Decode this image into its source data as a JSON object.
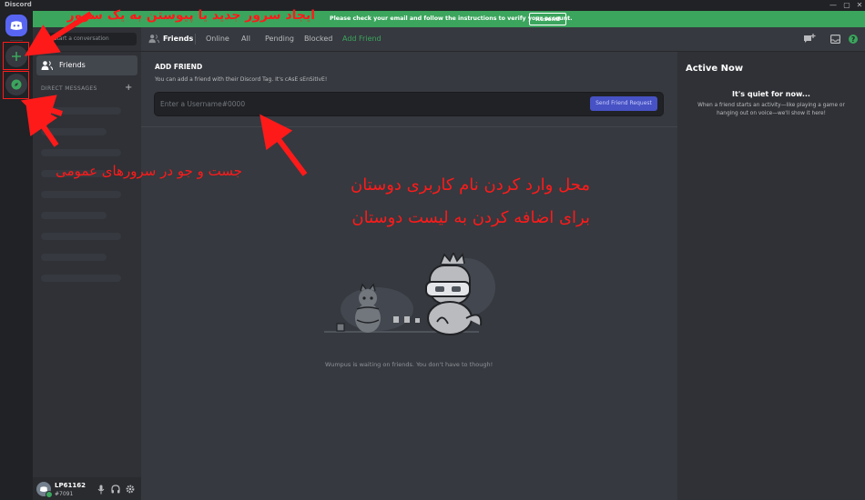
{
  "window": {
    "title": "Discord",
    "controls": [
      "—",
      "▢",
      "✕"
    ]
  },
  "banner": {
    "message": "Please check your email and follow the instructions to verify your account.",
    "button": "Resend",
    "color": "#3ba55d"
  },
  "sidebar": {
    "search_placeholder": "Find or start a conversation",
    "search_visible_text": "r start a conversation",
    "friends_label": "Friends",
    "direct_messages_header": "DIRECT MESSAGES",
    "add_dm_icon": "+"
  },
  "user": {
    "name": "LP61162",
    "tag": "#7091"
  },
  "header": {
    "friends_title": "Friends",
    "tabs": [
      "Online",
      "All",
      "Pending",
      "Blocked"
    ],
    "add_friend_tab": "Add Friend"
  },
  "add_friend": {
    "title": "ADD FRIEND",
    "description": "You can add a friend with their Discord Tag. It's cAsE sEnSitIvE!",
    "input_placeholder": "Enter a Username#0000",
    "button": "Send Friend Request"
  },
  "empty_state": {
    "caption": "Wumpus is waiting on friends. You don't have to though!"
  },
  "active_now": {
    "title": "Active Now",
    "quiet_title": "It's quiet for now...",
    "quiet_text_line1": "When a friend starts an activity—like playing a game or",
    "quiet_text_line2": "hanging out on voice—we'll show it here!"
  },
  "annotations": {
    "top": "ایجاد سرور جدید یا پیوستن به یک سرور",
    "left": "جست و جو در سرورهای عمومی",
    "center_line1": "محل وارد کردن نام کاربری دوستان",
    "center_line2": "برای اضافه کردن به لیست دوستان"
  },
  "colors": {
    "blurple": "#5865f2",
    "green": "#3ba55d",
    "annotation_red": "#ff1a1a",
    "button": "#4752c4"
  },
  "icons": [
    "discord-logo-icon",
    "plus-icon",
    "compass-icon",
    "friends-icon",
    "new-group-dm-icon",
    "inbox-icon",
    "help-icon",
    "microphone-icon",
    "headphones-icon",
    "gear-icon"
  ]
}
